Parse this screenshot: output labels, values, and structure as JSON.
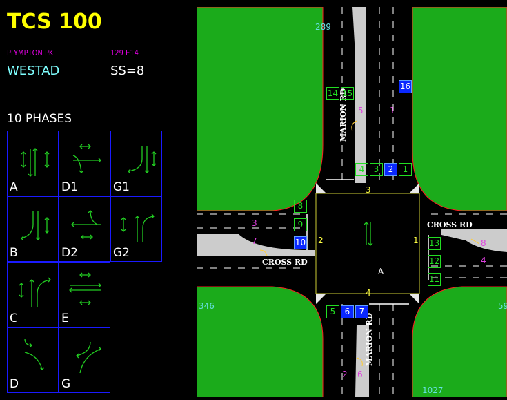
{
  "header": {
    "title": "TCS 100",
    "location": "PLYMPTON PK",
    "code": "129 E14",
    "region": "WESTAD",
    "ss": "SS=8",
    "phases_title": "10 PHASES"
  },
  "phases": [
    {
      "label": "A"
    },
    {
      "label": "D1"
    },
    {
      "label": "G1"
    },
    {
      "label": "B"
    },
    {
      "label": "D2"
    },
    {
      "label": "G2"
    },
    {
      "label": "C"
    },
    {
      "label": "E"
    },
    {
      "label": "D"
    },
    {
      "label": "G"
    }
  ],
  "map": {
    "top_count": "289",
    "left_count": "346",
    "right_count": "59",
    "bottom_count": "1027",
    "north_road": "MARION RD",
    "south_road": "MARION RD",
    "west_road": "CROSS RD",
    "east_road": "CROSS RD",
    "center_phase": "A",
    "approach_labels": {
      "north": "3",
      "west": "2",
      "east": "1",
      "south": "4"
    },
    "lane_numbers": {
      "n_left": "5",
      "n_right": "1",
      "w_top": "3",
      "w_bottom": "7",
      "e_top": "8",
      "e_bottom": "4",
      "s_left": "2",
      "s_right": "6"
    },
    "detectors": {
      "d14": "14",
      "d15": "15",
      "d16": "16",
      "d4": "4",
      "d3": "3",
      "d2": "2",
      "d1": "1",
      "d8": "8",
      "d9": "9",
      "d10": "10",
      "d13": "13",
      "d12": "12",
      "d11": "11",
      "d5": "5",
      "d6": "6",
      "d7": "7"
    },
    "colors": {
      "grass": "#1bab1b",
      "road": "#000000",
      "active_detector": "#0a28ff",
      "detector": "#22dd22"
    }
  }
}
